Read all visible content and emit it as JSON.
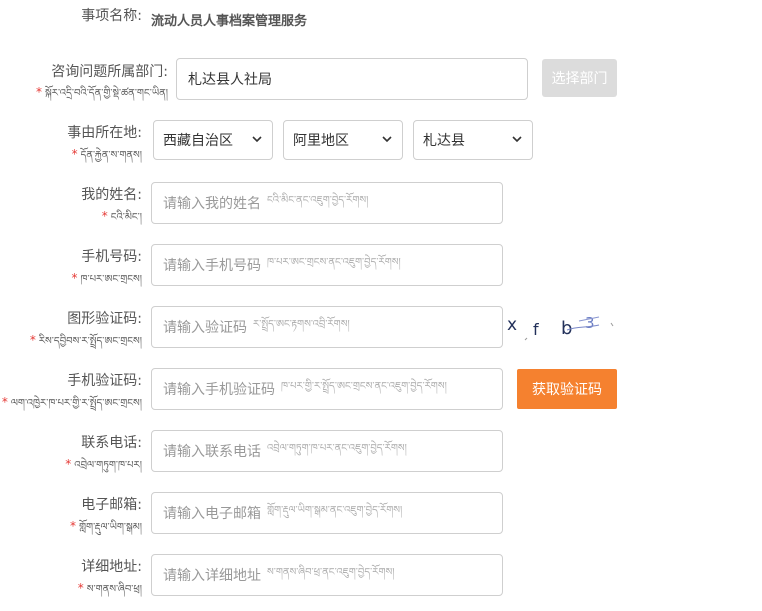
{
  "item": {
    "label": "事项名称:",
    "value": "流动人员人事档案管理服务"
  },
  "department": {
    "label_zh": "咨询问题所属部门:",
    "label_bo": "སྐོར་འདྲི་བའི་དོན་གྱི་སྡེ་ཚན་གང་ཡིན།",
    "value": "札达县人社局",
    "button": "选择部门"
  },
  "location": {
    "label_zh": "事由所在地:",
    "label_bo": "དོན་རྐྱེན་ས་གནས།",
    "province": "西藏自治区",
    "prefecture": "阿里地区",
    "county": "札达县"
  },
  "name": {
    "label_zh": "我的姓名:",
    "label_bo": "ངའི་མིང་།",
    "placeholder_zh": "请输入我的姓名",
    "placeholder_bo": "ངའི་མིང་ནང་འཇུག་བྱེད་རོགས།"
  },
  "phone": {
    "label_zh": "手机号码:",
    "label_bo": "ཁ་པར་ཨང་གྲངས།",
    "placeholder_zh": "请输入手机号码",
    "placeholder_bo": "ཁ་པར་ཨང་གྲངས་ནང་འཇུག་བྱེད་རོགས།"
  },
  "captcha_img": {
    "label_zh": "图形验证码:",
    "label_bo": "རིས་དབྱིབས་ར་སྤྲོད་ཨང་གྲངས།",
    "placeholder_zh": "请输入验证码",
    "placeholder_bo": "ར་སྤྲོད་ཨང་རྟགས་འབྲི་རོགས།",
    "code": "xfb3"
  },
  "sms_code": {
    "label_zh": "手机验证码:",
    "label_bo": "ལག་འཁྱེར་ཁ་པར་གྱི་ར་སྤྲོད་ཨང་གྲངས།",
    "placeholder_zh": "请输入手机验证码",
    "placeholder_bo": "ཁ་པར་གྱི་ར་སྤྲོད་ཨང་གྲངས་ནང་འཇུག་བྱེད་རོགས།",
    "button": "获取验证码"
  },
  "contact_phone": {
    "label_zh": "联系电话:",
    "label_bo": "འབྲེལ་གཏུག་ཁ་པར།",
    "placeholder_zh": "请输入联系电话",
    "placeholder_bo": "འབྲེལ་གཏུག་ཁ་པར་ནང་འཇུག་བྱེད་རོགས།"
  },
  "email": {
    "label_zh": "电子邮箱:",
    "label_bo": "གློག་རྡུལ་ཡིག་སྒམ།",
    "placeholder_zh": "请输入电子邮箱",
    "placeholder_bo": "གློག་རྡུལ་ཡིག་སྒམ་ནང་འཇུག་བྱེད་རོགས།"
  },
  "address": {
    "label_zh": "详细地址:",
    "label_bo": "ས་གནས་ཞིབ་ཕྲ།",
    "placeholder_zh": "请输入详细地址",
    "placeholder_bo": "ས་གནས་ཞིབ་ཕྲ་ནང་འཇུག་བྱེད་རོགས།"
  },
  "colors": {
    "accent": "#f5812f",
    "required": "#e53935",
    "disabled_button": "#dcdcdc"
  }
}
